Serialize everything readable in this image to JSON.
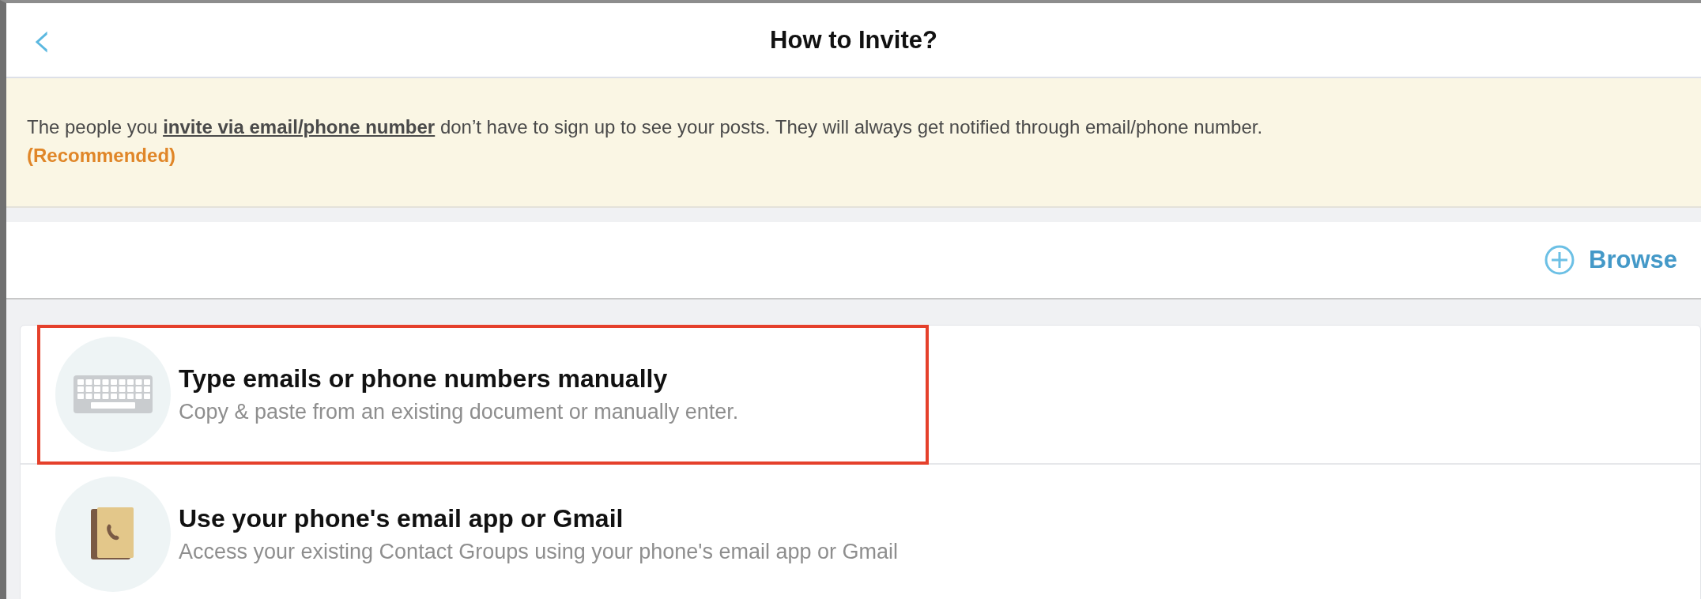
{
  "header": {
    "back": "‹",
    "title": "How to Invite?"
  },
  "notice": {
    "text": "The people you **invite via email/phone number** don’t have to sign up to see your posts. They will always get notified through email/phone number.",
    "tag": "(Recommended)"
  },
  "browse": {
    "label": "Browse"
  },
  "options": [
    {
      "kind": "keyboard",
      "title": "Type emails or phone numbers manually",
      "subtitle": "Copy & paste from an existing document or manually enter.",
      "highlighted": true
    },
    {
      "kind": "contacts",
      "title": "Use your phone's email app or Gmail",
      "subtitle": "Access your existing Contact Groups using your phone's email app or Gmail",
      "highlighted": false
    }
  ]
}
